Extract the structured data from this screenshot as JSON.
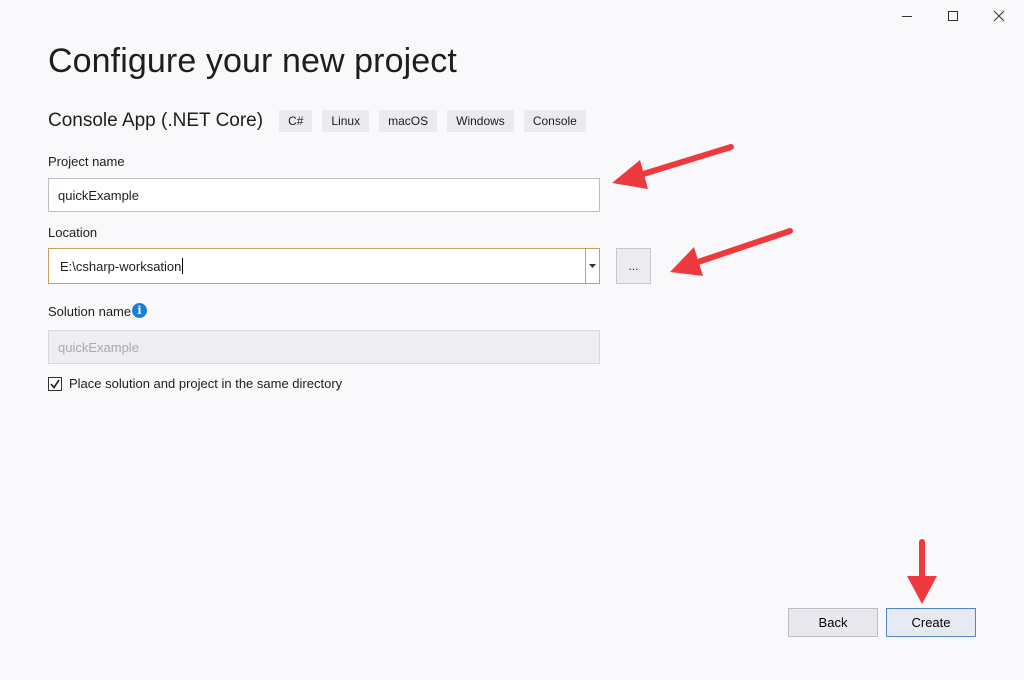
{
  "window": {
    "controls": {
      "minimize_icon": "minimize-icon",
      "maximize_icon": "maximize-icon",
      "close_icon": "close-icon"
    }
  },
  "header": {
    "title": "Configure your new project",
    "template_name": "Console App (.NET Core)",
    "tags": [
      "C#",
      "Linux",
      "macOS",
      "Windows",
      "Console"
    ]
  },
  "form": {
    "project_name_label": "Project name",
    "project_name_value": "quickExample",
    "location_label": "Location",
    "location_value": "E:\\csharp-worksation",
    "browse_label": "...",
    "solution_name_label": "Solution name",
    "solution_name_value": "quickExample",
    "same_directory_label": "Place solution and project in the same directory",
    "same_directory_checked": true
  },
  "footer": {
    "back_label": "Back",
    "create_label": "Create"
  },
  "annotations": {
    "arrow_color": "#ee3a3e"
  }
}
